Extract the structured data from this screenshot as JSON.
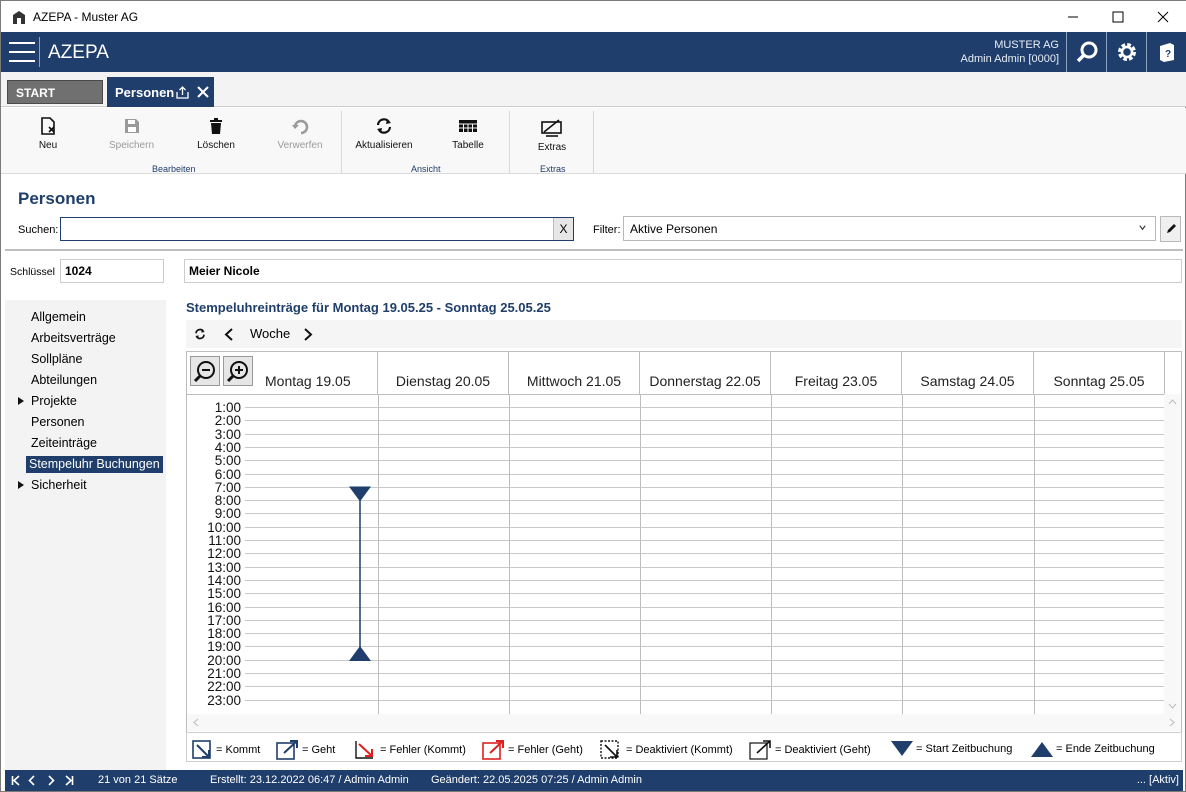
{
  "window": {
    "title": "AZEPA - Muster AG"
  },
  "header": {
    "brand": "AZEPA",
    "company": "MUSTER AG",
    "user": "Admin Admin [0000]"
  },
  "tabs": {
    "start": "START",
    "active": "Personen"
  },
  "ribbon": {
    "buttons": [
      {
        "label": "Neu",
        "icon": "new-document-icon"
      },
      {
        "label": "Speichern",
        "icon": "save-icon"
      },
      {
        "label": "Löschen",
        "icon": "trash-icon"
      },
      {
        "label": "Verwerfen",
        "icon": "undo-icon"
      },
      {
        "label": "Aktualisieren",
        "icon": "refresh-icon"
      },
      {
        "label": "Tabelle",
        "icon": "table-icon"
      },
      {
        "label": "Extras",
        "icon": "extras-icon"
      }
    ],
    "groups": [
      "Bearbeiten",
      "Ansicht",
      "Extras"
    ]
  },
  "page": {
    "title": "Personen",
    "search_label": "Suchen:",
    "search_value": "",
    "search_clear": "X",
    "filter_label": "Filter:",
    "filter_value": "Aktive Personen"
  },
  "record": {
    "key_label": "Schlüssel",
    "key": "1024",
    "name": "Meier Nicole"
  },
  "sidebar": {
    "items": [
      {
        "label": "Allgemein"
      },
      {
        "label": "Arbeitsverträge"
      },
      {
        "label": "Sollpläne"
      },
      {
        "label": "Abteilungen"
      },
      {
        "label": "Projekte"
      },
      {
        "label": "Personen"
      },
      {
        "label": "Zeiteinträge"
      },
      {
        "label": "Stempeluhr Buchungen"
      },
      {
        "label": "Sicherheit"
      }
    ]
  },
  "calendar": {
    "heading": "Stempeluhreinträge für Montag 19.05.25 - Sonntag 25.05.25",
    "view": "Woche",
    "days": [
      "Montag 19.05",
      "Dienstag 20.05",
      "Mittwoch 21.05",
      "Donnerstag 22.05",
      "Freitag 23.05",
      "Samstag 24.05",
      "Sonntag 25.05"
    ],
    "hours": [
      "1:00",
      "2:00",
      "3:00",
      "4:00",
      "5:00",
      "6:00",
      "7:00",
      "8:00",
      "9:00",
      "10:00",
      "11:00",
      "12:00",
      "13:00",
      "14:00",
      "15:00",
      "16:00",
      "17:00",
      "18:00",
      "19:00",
      "20:00",
      "21:00",
      "22:00",
      "23:00"
    ],
    "booking": {
      "day": "Montag 19.05",
      "start": "7:30",
      "end": "19:30"
    }
  },
  "legend": {
    "items": [
      "= Kommt",
      "= Geht",
      "= Fehler (Kommt)",
      "= Fehler (Geht)",
      "= Deaktiviert (Kommt)",
      "= Deaktiviert (Geht)",
      "= Start Zeitbuchung",
      "= Ende Zeitbuchung"
    ]
  },
  "status": {
    "count": "21 von 21 Sätze",
    "created": "Erstellt: 23.12.2022 06:47 / Admin Admin",
    "changed": "Geändert: 22.05.2025 07:25 / Admin Admin",
    "state": "... [Aktiv]"
  },
  "colors": {
    "accent": "#1f3e6b",
    "error": "#e02020"
  }
}
